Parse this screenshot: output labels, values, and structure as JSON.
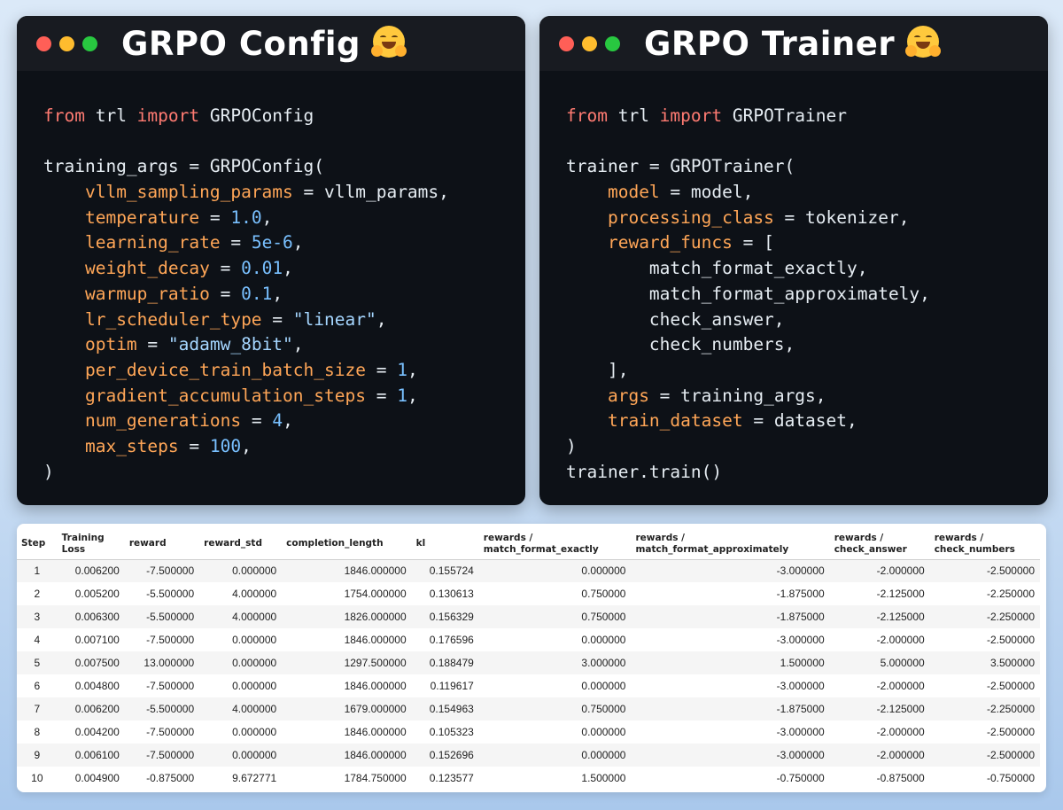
{
  "left_panel": {
    "title": "GRPO Config",
    "title_icon": "hugging-face-icon",
    "lines": [
      [
        {
          "t": "from",
          "c": "kw"
        },
        {
          "t": " trl ",
          "c": "plain"
        },
        {
          "t": "import",
          "c": "kw"
        },
        {
          "t": " GRPOConfig",
          "c": "plain"
        }
      ],
      [],
      [
        {
          "t": "training_args = GRPOConfig(",
          "c": "plain"
        }
      ],
      [
        {
          "t": "    ",
          "c": "plain"
        },
        {
          "t": "vllm_sampling_params",
          "c": "arg"
        },
        {
          "t": " = ",
          "c": "plain"
        },
        {
          "t": "vllm_params,",
          "c": "plain"
        }
      ],
      [
        {
          "t": "    ",
          "c": "plain"
        },
        {
          "t": "temperature",
          "c": "arg"
        },
        {
          "t": " = ",
          "c": "plain"
        },
        {
          "t": "1.0",
          "c": "num"
        },
        {
          "t": ",",
          "c": "plain"
        }
      ],
      [
        {
          "t": "    ",
          "c": "plain"
        },
        {
          "t": "learning_rate",
          "c": "arg"
        },
        {
          "t": " = ",
          "c": "plain"
        },
        {
          "t": "5e-6",
          "c": "num"
        },
        {
          "t": ",",
          "c": "plain"
        }
      ],
      [
        {
          "t": "    ",
          "c": "plain"
        },
        {
          "t": "weight_decay",
          "c": "arg"
        },
        {
          "t": " = ",
          "c": "plain"
        },
        {
          "t": "0.01",
          "c": "num"
        },
        {
          "t": ",",
          "c": "plain"
        }
      ],
      [
        {
          "t": "    ",
          "c": "plain"
        },
        {
          "t": "warmup_ratio",
          "c": "arg"
        },
        {
          "t": " = ",
          "c": "plain"
        },
        {
          "t": "0.1",
          "c": "num"
        },
        {
          "t": ",",
          "c": "plain"
        }
      ],
      [
        {
          "t": "    ",
          "c": "plain"
        },
        {
          "t": "lr_scheduler_type",
          "c": "arg"
        },
        {
          "t": " = ",
          "c": "plain"
        },
        {
          "t": "\"linear\"",
          "c": "str"
        },
        {
          "t": ",",
          "c": "plain"
        }
      ],
      [
        {
          "t": "    ",
          "c": "plain"
        },
        {
          "t": "optim",
          "c": "arg"
        },
        {
          "t": " = ",
          "c": "plain"
        },
        {
          "t": "\"adamw_8bit\"",
          "c": "str"
        },
        {
          "t": ",",
          "c": "plain"
        }
      ],
      [
        {
          "t": "    ",
          "c": "plain"
        },
        {
          "t": "per_device_train_batch_size",
          "c": "arg"
        },
        {
          "t": " = ",
          "c": "plain"
        },
        {
          "t": "1",
          "c": "num"
        },
        {
          "t": ",",
          "c": "plain"
        }
      ],
      [
        {
          "t": "    ",
          "c": "plain"
        },
        {
          "t": "gradient_accumulation_steps",
          "c": "arg"
        },
        {
          "t": " = ",
          "c": "plain"
        },
        {
          "t": "1",
          "c": "num"
        },
        {
          "t": ",",
          "c": "plain"
        }
      ],
      [
        {
          "t": "    ",
          "c": "plain"
        },
        {
          "t": "num_generations",
          "c": "arg"
        },
        {
          "t": " = ",
          "c": "plain"
        },
        {
          "t": "4",
          "c": "num"
        },
        {
          "t": ",",
          "c": "plain"
        }
      ],
      [
        {
          "t": "    ",
          "c": "plain"
        },
        {
          "t": "max_steps",
          "c": "arg"
        },
        {
          "t": " = ",
          "c": "plain"
        },
        {
          "t": "100",
          "c": "num"
        },
        {
          "t": ",",
          "c": "plain"
        }
      ],
      [
        {
          "t": ")",
          "c": "plain"
        }
      ]
    ]
  },
  "right_panel": {
    "title": "GRPO Trainer",
    "title_icon": "hugging-face-icon",
    "lines": [
      [
        {
          "t": "from",
          "c": "kw"
        },
        {
          "t": " trl ",
          "c": "plain"
        },
        {
          "t": "import",
          "c": "kw"
        },
        {
          "t": " GRPOTrainer",
          "c": "plain"
        }
      ],
      [],
      [
        {
          "t": "trainer = GRPOTrainer(",
          "c": "plain"
        }
      ],
      [
        {
          "t": "    ",
          "c": "plain"
        },
        {
          "t": "model",
          "c": "arg"
        },
        {
          "t": " = ",
          "c": "plain"
        },
        {
          "t": "model,",
          "c": "plain"
        }
      ],
      [
        {
          "t": "    ",
          "c": "plain"
        },
        {
          "t": "processing_class",
          "c": "arg"
        },
        {
          "t": " = ",
          "c": "plain"
        },
        {
          "t": "tokenizer,",
          "c": "plain"
        }
      ],
      [
        {
          "t": "    ",
          "c": "plain"
        },
        {
          "t": "reward_funcs",
          "c": "arg"
        },
        {
          "t": " = [",
          "c": "plain"
        }
      ],
      [
        {
          "t": "        match_format_exactly,",
          "c": "plain"
        }
      ],
      [
        {
          "t": "        match_format_approximately,",
          "c": "plain"
        }
      ],
      [
        {
          "t": "        check_answer,",
          "c": "plain"
        }
      ],
      [
        {
          "t": "        check_numbers,",
          "c": "plain"
        }
      ],
      [
        {
          "t": "    ],",
          "c": "plain"
        }
      ],
      [
        {
          "t": "    ",
          "c": "plain"
        },
        {
          "t": "args",
          "c": "arg"
        },
        {
          "t": " = ",
          "c": "plain"
        },
        {
          "t": "training_args,",
          "c": "plain"
        }
      ],
      [
        {
          "t": "    ",
          "c": "plain"
        },
        {
          "t": "train_dataset",
          "c": "arg"
        },
        {
          "t": " = ",
          "c": "plain"
        },
        {
          "t": "dataset,",
          "c": "plain"
        }
      ],
      [
        {
          "t": ")",
          "c": "plain"
        }
      ],
      [
        {
          "t": "trainer.train()",
          "c": "plain"
        }
      ]
    ]
  },
  "colors": {
    "keyword": "#ff7b72",
    "argument": "#ffa657",
    "number": "#79c0ff",
    "string": "#a5d6ff",
    "plain": "#e6edf3",
    "window_bg": "#0d1117",
    "titlebar_bg": "#181b21",
    "dot_red": "#ff5f57",
    "dot_yellow": "#febc2e",
    "dot_green": "#28c840"
  },
  "table": {
    "columns": [
      {
        "l1": "Step",
        "l2": ""
      },
      {
        "l1": "Training",
        "l2": "Loss"
      },
      {
        "l1": "reward",
        "l2": ""
      },
      {
        "l1": "reward_std",
        "l2": ""
      },
      {
        "l1": "completion_length",
        "l2": ""
      },
      {
        "l1": "kl",
        "l2": ""
      },
      {
        "l1": "rewards /",
        "l2": "match_format_exactly"
      },
      {
        "l1": "rewards /",
        "l2": "match_format_approximately"
      },
      {
        "l1": "rewards /",
        "l2": "check_answer"
      },
      {
        "l1": "rewards /",
        "l2": "check_numbers"
      }
    ],
    "rows": [
      [
        "1",
        "0.006200",
        "-7.500000",
        "0.000000",
        "1846.000000",
        "0.155724",
        "0.000000",
        "-3.000000",
        "-2.000000",
        "-2.500000"
      ],
      [
        "2",
        "0.005200",
        "-5.500000",
        "4.000000",
        "1754.000000",
        "0.130613",
        "0.750000",
        "-1.875000",
        "-2.125000",
        "-2.250000"
      ],
      [
        "3",
        "0.006300",
        "-5.500000",
        "4.000000",
        "1826.000000",
        "0.156329",
        "0.750000",
        "-1.875000",
        "-2.125000",
        "-2.250000"
      ],
      [
        "4",
        "0.007100",
        "-7.500000",
        "0.000000",
        "1846.000000",
        "0.176596",
        "0.000000",
        "-3.000000",
        "-2.000000",
        "-2.500000"
      ],
      [
        "5",
        "0.007500",
        "13.000000",
        "0.000000",
        "1297.500000",
        "0.188479",
        "3.000000",
        "1.500000",
        "5.000000",
        "3.500000"
      ],
      [
        "6",
        "0.004800",
        "-7.500000",
        "0.000000",
        "1846.000000",
        "0.119617",
        "0.000000",
        "-3.000000",
        "-2.000000",
        "-2.500000"
      ],
      [
        "7",
        "0.006200",
        "-5.500000",
        "4.000000",
        "1679.000000",
        "0.154963",
        "0.750000",
        "-1.875000",
        "-2.125000",
        "-2.250000"
      ],
      [
        "8",
        "0.004200",
        "-7.500000",
        "0.000000",
        "1846.000000",
        "0.105323",
        "0.000000",
        "-3.000000",
        "-2.000000",
        "-2.500000"
      ],
      [
        "9",
        "0.006100",
        "-7.500000",
        "0.000000",
        "1846.000000",
        "0.152696",
        "0.000000",
        "-3.000000",
        "-2.000000",
        "-2.500000"
      ],
      [
        "10",
        "0.004900",
        "-0.875000",
        "9.672771",
        "1784.750000",
        "0.123577",
        "1.500000",
        "-0.750000",
        "-0.875000",
        "-0.750000"
      ]
    ]
  }
}
